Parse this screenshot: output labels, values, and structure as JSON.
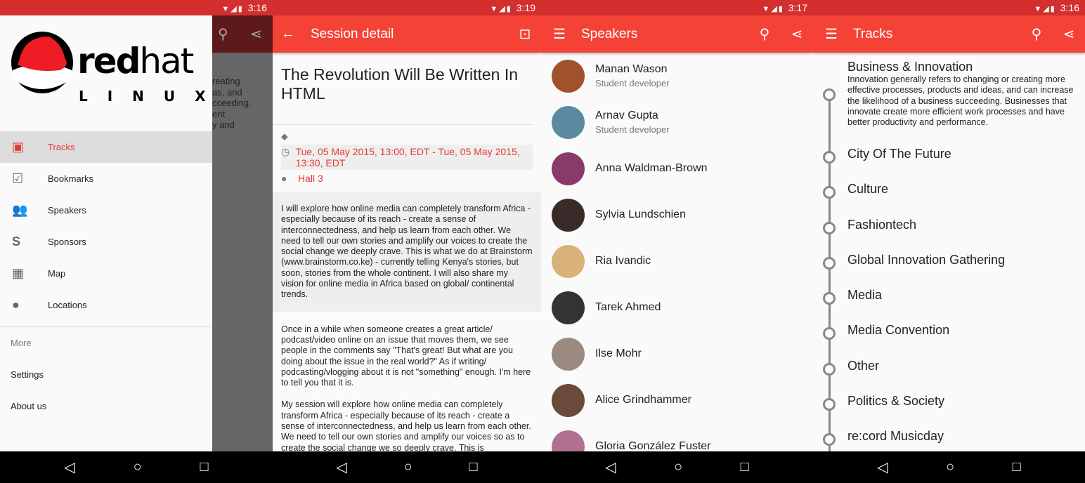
{
  "panel1": {
    "time": "3:16",
    "logo_text": "redhat LINUX",
    "menu": [
      {
        "label": "Tracks",
        "icon": "calendar-icon",
        "active": true
      },
      {
        "label": "Bookmarks",
        "icon": "bookmark-check-icon"
      },
      {
        "label": "Speakers",
        "icon": "people-icon"
      },
      {
        "label": "Sponsors",
        "icon": "dollar-icon"
      },
      {
        "label": "Map",
        "icon": "map-icon"
      },
      {
        "label": "Locations",
        "icon": "location-pin-icon"
      }
    ],
    "more_header": "More",
    "settings": "Settings",
    "about": "About us",
    "behind_text": [
      "reating",
      "as, and",
      "cceeding.",
      "ent",
      "y and"
    ]
  },
  "panel2": {
    "time": "3:19",
    "title": "Session detail",
    "session_title": "The Revolution Will Be Written In HTML",
    "datetime": "Tue, 05 May 2015, 13:00, EDT - Tue, 05 May 2015, 13:30, EDT",
    "location": "Hall 3",
    "abstract": "I will explore how online media can completely transform Africa - especially because of its reach - create a sense of interconnectedness, and help us learn from each other. We need to tell our own stories and amplify our voices to create the social change we deeply crave. This is what we do at Brainstorm (www.brainstorm.co.ke) - currently telling Kenya's stories, but soon, stories from the whole continent. I will also share my vision for online media in Africa based on global/ continental trends.",
    "para1": "Once in a while when someone creates a great article/ podcast/video online on an issue that moves them, we see people in the comments say \"That's great! But what are you doing about the issue in the real world?\" As if writing/ podcasting/vlogging about it is not \"something\" enough. I'm here to tell you that it is.",
    "para2": "My session will explore how online media can completely transform Africa - especially because of its reach - create a sense of interconnectedness, and help us learn from each other. We need to tell our own stories and amplify our voices so as to create the social change we so deeply crave. This is"
  },
  "panel3": {
    "time": "3:17",
    "title": "Speakers",
    "speakers": [
      {
        "name": "Manan Wason",
        "role": "Student developer"
      },
      {
        "name": "Arnav Gupta",
        "role": "Student developer"
      },
      {
        "name": "Anna Waldman-Brown"
      },
      {
        "name": "Sylvia Lundschien"
      },
      {
        "name": "Ria Ivandic"
      },
      {
        "name": "Tarek Ahmed"
      },
      {
        "name": "Ilse Mohr"
      },
      {
        "name": "Alice Grindhammer"
      },
      {
        "name": "Gloria González Fuster"
      }
    ]
  },
  "panel4": {
    "time": "3:16",
    "title": "Tracks",
    "tracks": [
      {
        "name": "Business & Innovation",
        "desc": "Innovation generally refers to changing or creating more effective processes, products and ideas, and can increase the likelihood of a business succeeding. Businesses that innovate create more efficient work processes and have better productivity and performance."
      },
      {
        "name": "City Of The Future"
      },
      {
        "name": "Culture"
      },
      {
        "name": "Fashiontech"
      },
      {
        "name": "Global Innovation Gathering"
      },
      {
        "name": "Media"
      },
      {
        "name": "Media Convention"
      },
      {
        "name": "Other"
      },
      {
        "name": "Politics & Society"
      },
      {
        "name": "re:cord Musicday"
      }
    ]
  },
  "colors": {
    "primary": "#f44336",
    "status": "#d32f2f",
    "accent": "#e53935"
  }
}
